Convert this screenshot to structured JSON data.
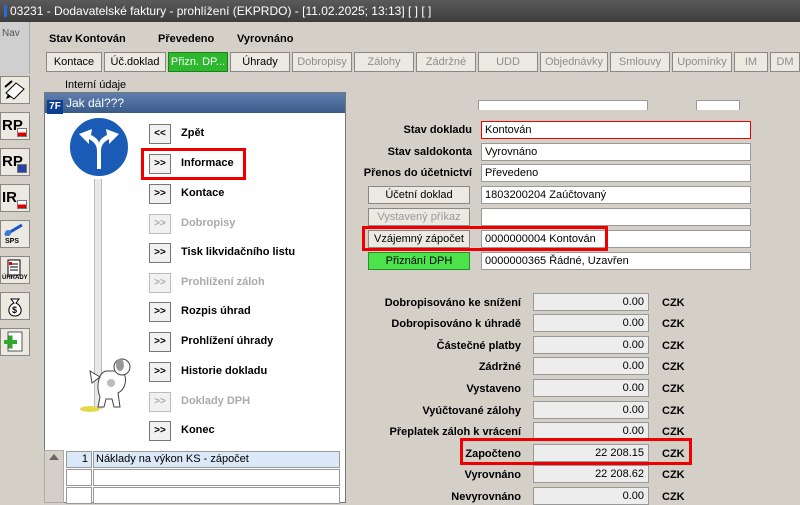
{
  "window": {
    "title": "03231 - Dodavatelské faktury - prohlížení (EKPRDO) - [11.02.2025; 13:13]  [ ]  [ ]"
  },
  "top_left": {
    "nav_label": "Nav"
  },
  "sidebar": {
    "items": [
      {
        "name": "edit-icon",
        "label": ""
      },
      {
        "name": "rp-cz-button",
        "label": "RP"
      },
      {
        "name": "rp-eu-button",
        "label": "RP"
      },
      {
        "name": "ir-cz-button",
        "label": "IR"
      },
      {
        "name": "sps-button",
        "label": "SPS"
      },
      {
        "name": "uhrady-button",
        "label": "ÚHRADY"
      },
      {
        "name": "money-bag-icon",
        "label": ""
      },
      {
        "name": "add-document-icon",
        "label": ""
      }
    ]
  },
  "status_bar": {
    "stav_label": "Stav",
    "stav_value": "Kontován",
    "prevedeno": "Převedeno",
    "vyrovnano": "Vyrovnáno"
  },
  "tabs": [
    {
      "label": "Kontace",
      "state": "normal"
    },
    {
      "label": "Úč.doklad",
      "state": "normal"
    },
    {
      "label": "Přizn. DP...",
      "state": "active"
    },
    {
      "label": "Úhrady",
      "state": "normal"
    },
    {
      "label": "Dobropisy",
      "state": "disabled"
    },
    {
      "label": "Zálohy",
      "state": "disabled"
    },
    {
      "label": "Zádržné",
      "state": "disabled"
    },
    {
      "label": "UDD",
      "state": "disabled"
    },
    {
      "label": "Objednávky",
      "state": "disabled"
    },
    {
      "label": "Smlouvy",
      "state": "disabled"
    },
    {
      "label": "Upomínky",
      "state": "disabled"
    },
    {
      "label": "IM",
      "state": "disabled"
    },
    {
      "label": "DM",
      "state": "disabled"
    }
  ],
  "interni_label": "Interní údaje",
  "dialog": {
    "title": "Jak dál???",
    "app_icon": "7F",
    "menu": [
      {
        "btn": "<<",
        "label": "Zpět",
        "enabled": true
      },
      {
        "btn": ">>",
        "label": "Informace",
        "enabled": true
      },
      {
        "btn": ">>",
        "label": "Kontace",
        "enabled": true
      },
      {
        "btn": ">>",
        "label": "Dobropisy",
        "enabled": false
      },
      {
        "btn": ">>",
        "label": "Tisk likvidačního listu",
        "enabled": true
      },
      {
        "btn": ">>",
        "label": "Prohlížení záloh",
        "enabled": false
      },
      {
        "btn": ">>",
        "label": "Rozpis úhrad",
        "enabled": true
      },
      {
        "btn": ">>",
        "label": "Prohlížení úhrady",
        "enabled": true
      },
      {
        "btn": ">>",
        "label": "Historie dokladu",
        "enabled": true
      },
      {
        "btn": ">>",
        "label": "Doklady DPH",
        "enabled": false
      },
      {
        "btn": ">>",
        "label": "Konec",
        "enabled": true
      }
    ]
  },
  "info": {
    "stav_dokladu_label": "Stav dokladu",
    "stav_dokladu": "Kontován",
    "stav_saldokonta_label": "Stav saldokonta",
    "stav_saldokonta": "Vyrovnáno",
    "prenos_label": "Přenos do účetnictví",
    "prenos": "Převedeno",
    "ucetni_doklad_btn": "Účetní doklad",
    "ucetni_doklad": "1803200204 Zaúčtovaný",
    "vystaveny_prikaz_btn": "Vystavený příkaz",
    "vystaveny_prikaz": "",
    "vzajemny_zapocet_btn": "Vzájemný zápočet",
    "vzajemny_zapocet": "0000000004 Kontován",
    "priznani_dph_btn": "Přiznání DPH",
    "priznani_dph": "0000000365 Řádné, Uzavřen"
  },
  "amounts": [
    {
      "label": "Dobropisováno ke snížení",
      "value": "0.00",
      "currency": "CZK"
    },
    {
      "label": "Dobropisováno k úhradě",
      "value": "0.00",
      "currency": "CZK"
    },
    {
      "label": "Částečné platby",
      "value": "0.00",
      "currency": "CZK"
    },
    {
      "label": "Zádržné",
      "value": "0.00",
      "currency": "CZK"
    },
    {
      "label": "Vystaveno",
      "value": "0.00",
      "currency": "CZK"
    },
    {
      "label": "Vyúčtované zálohy",
      "value": "0.00",
      "currency": "CZK"
    },
    {
      "label": "Přeplatek záloh k vrácení",
      "value": "0.00",
      "currency": "CZK"
    },
    {
      "label": "Započteno",
      "value": "22 208.15",
      "currency": "CZK"
    },
    {
      "label": "Vyrovnáno",
      "value": "22 208.62",
      "currency": "CZK"
    },
    {
      "label": "Nevyrovnáno",
      "value": "0.00",
      "currency": "CZK"
    }
  ],
  "grid": {
    "rows": [
      {
        "num": "1",
        "text": "Náklady na výkon KS - zápočet"
      },
      {
        "num": "",
        "text": ""
      },
      {
        "num": "",
        "text": ""
      }
    ]
  }
}
